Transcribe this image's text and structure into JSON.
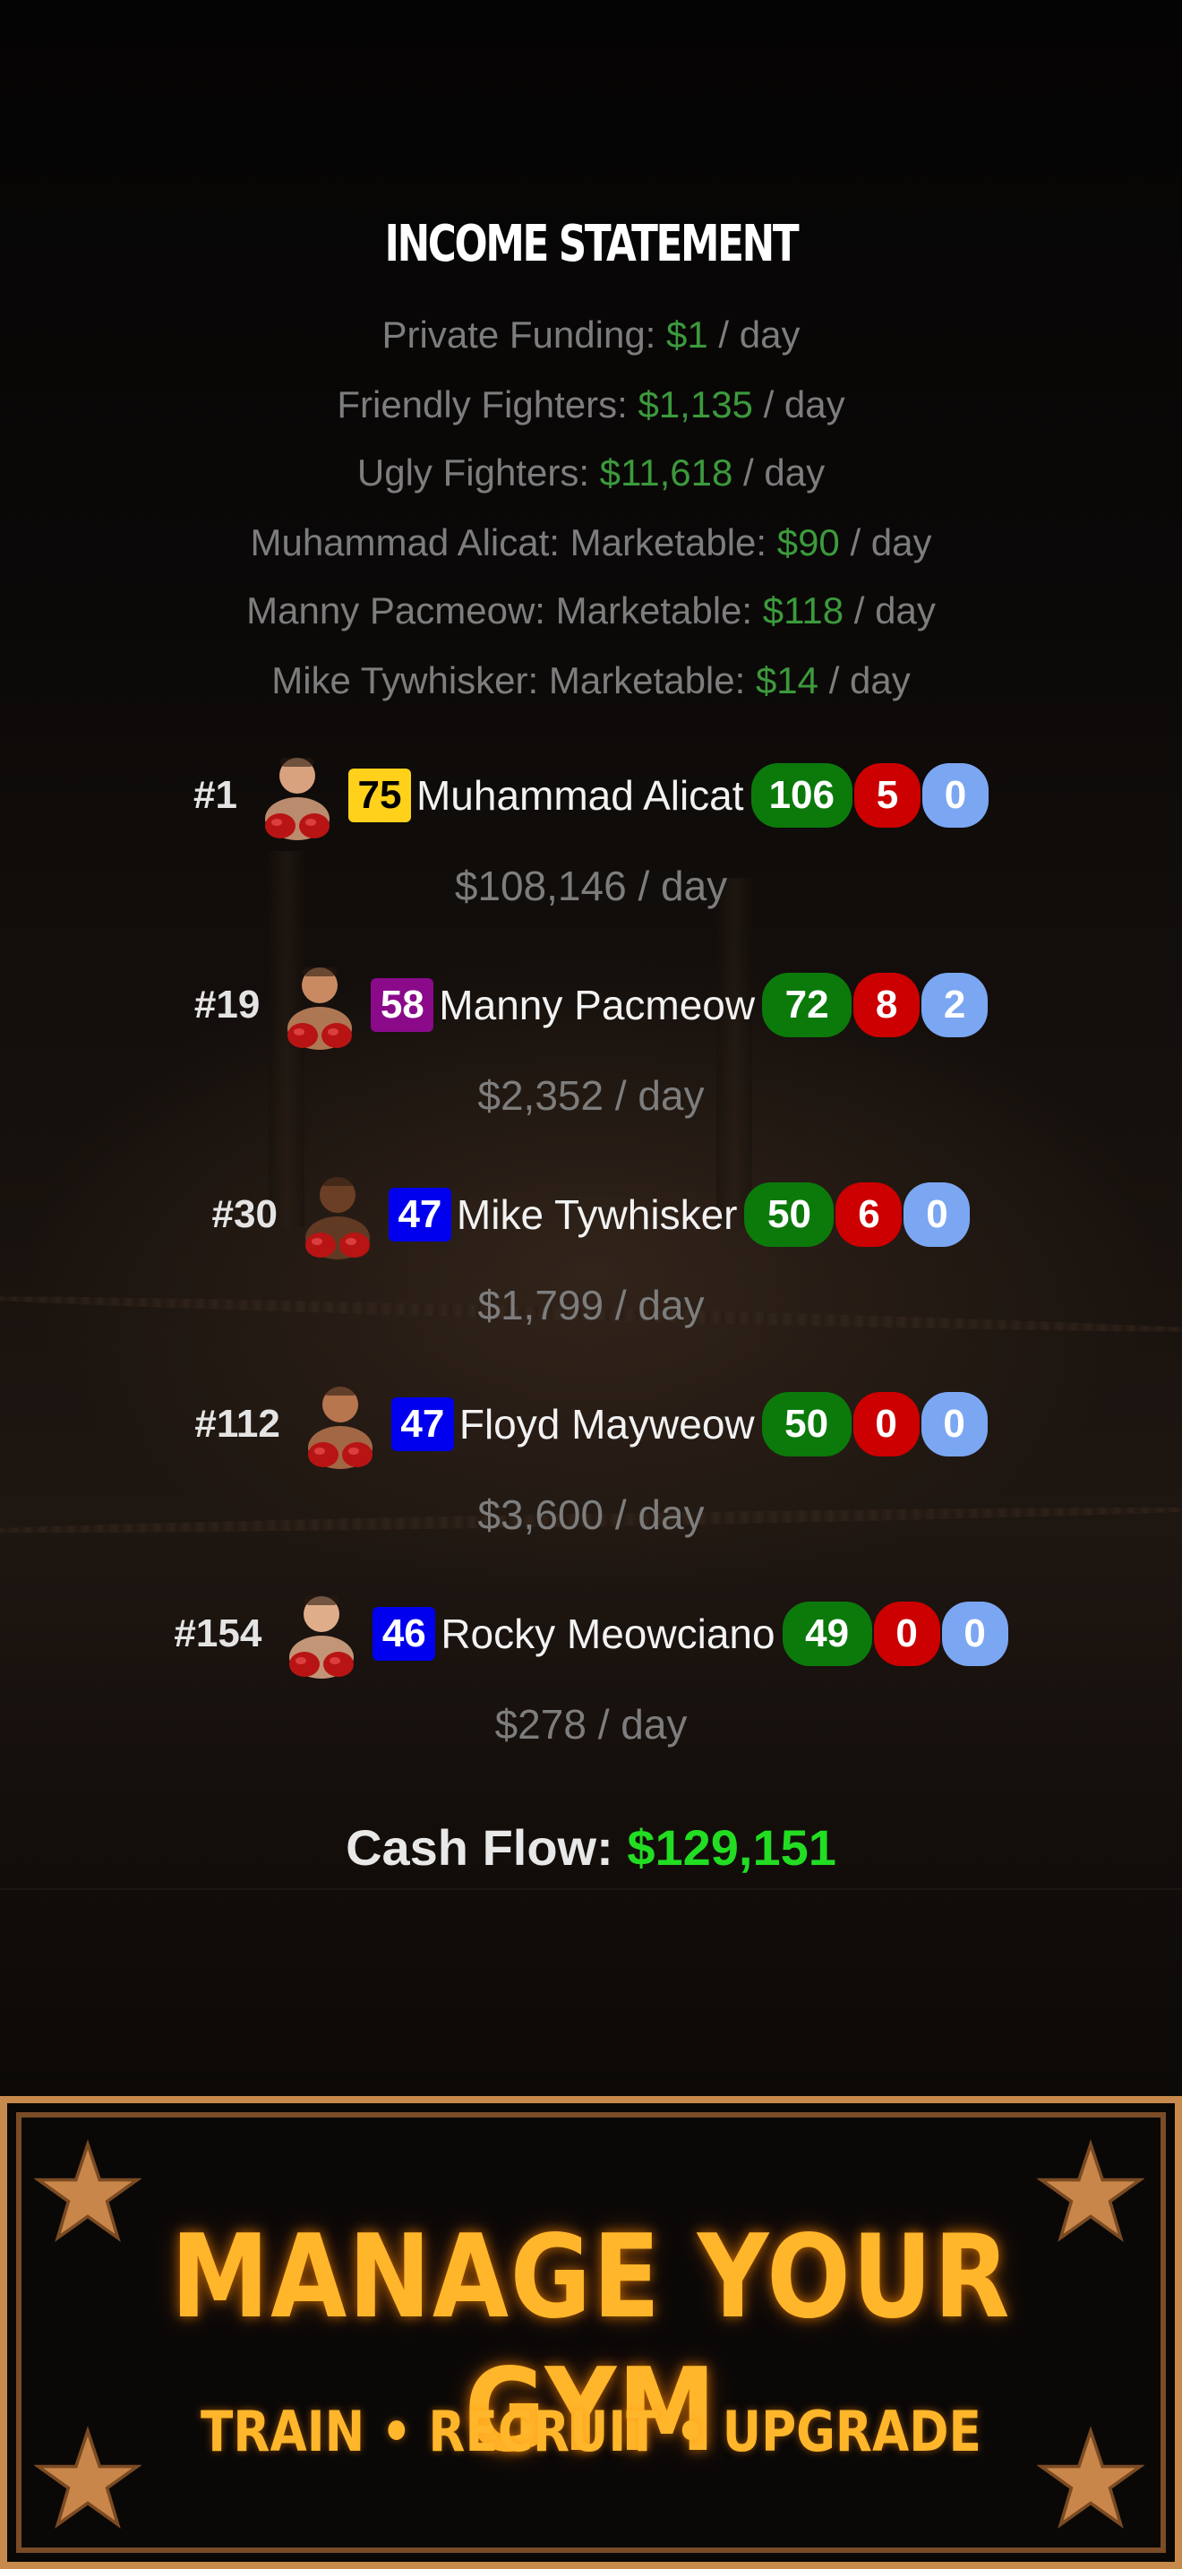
{
  "income_statement": {
    "title": "INCOME STATEMENT",
    "lines": [
      {
        "label": "Private Funding:",
        "amount": "$1",
        "period": "/ day"
      },
      {
        "label": "Friendly Fighters:",
        "amount": "$1,135",
        "period": "/ day"
      },
      {
        "label": "Ugly Fighters:",
        "amount": "$11,618",
        "period": "/ day"
      },
      {
        "label": "Muhammad Alicat: Marketable:",
        "amount": "$90",
        "period": "/ day"
      },
      {
        "label": "Manny Pacmeow: Marketable:",
        "amount": "$118",
        "period": "/ day"
      },
      {
        "label": "Mike Tywhisker: Marketable:",
        "amount": "$14",
        "period": "/ day"
      }
    ]
  },
  "fighters": [
    {
      "rank": "#1",
      "ovr": "75",
      "ovr_bg": "#ffd11a",
      "ovr_fg": "#000000",
      "name": "Muhammad Alicat",
      "wins": "106",
      "losses": "5",
      "draws": "0",
      "daily": "$108,146 / day",
      "skin": "#d9a27f"
    },
    {
      "rank": "#19",
      "ovr": "58",
      "ovr_bg": "#8a0a8a",
      "ovr_fg": "#ffffff",
      "name": "Manny Pacmeow",
      "wins": "72",
      "losses": "8",
      "draws": "2",
      "daily": "$2,352 / day",
      "skin": "#c98a62"
    },
    {
      "rank": "#30",
      "ovr": "47",
      "ovr_bg": "#0000ee",
      "ovr_fg": "#ffffff",
      "name": "Mike Tywhisker",
      "wins": "50",
      "losses": "6",
      "draws": "0",
      "daily": "$1,799 / day",
      "skin": "#6b3f26"
    },
    {
      "rank": "#112",
      "ovr": "47",
      "ovr_bg": "#0000ee",
      "ovr_fg": "#ffffff",
      "name": "Floyd Mayweow",
      "wins": "50",
      "losses": "0",
      "draws": "0",
      "daily": "$3,600 / day",
      "skin": "#b8764e"
    },
    {
      "rank": "#154",
      "ovr": "46",
      "ovr_bg": "#0000ee",
      "ovr_fg": "#ffffff",
      "name": "Rocky Meowciano",
      "wins": "49",
      "losses": "0",
      "draws": "0",
      "daily": "$278 / day",
      "skin": "#e0ad8a"
    }
  ],
  "cash_flow": {
    "label": "Cash Flow:",
    "value": "$129,151"
  },
  "banner": {
    "title": "MANAGE YOUR GYM",
    "subtitle": "TRAIN • RECRUIT • UPGRADE"
  },
  "colors": {
    "money_green": "#3c9a3c",
    "cash_flow_green": "#22dd22",
    "banner_gold": "#ffb62a",
    "win_green": "#0b7a0b",
    "loss_red": "#cc0000",
    "draw_blue": "#7ba6f2"
  }
}
